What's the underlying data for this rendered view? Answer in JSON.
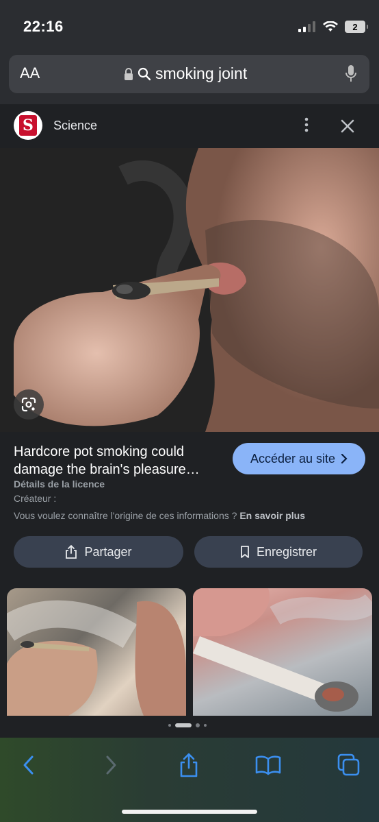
{
  "status_bar": {
    "time": "22:16",
    "battery": "2"
  },
  "url_bar": {
    "text_size_label": "AA",
    "query": "smoking joint"
  },
  "source": {
    "logo_letter": "S",
    "name": "Science"
  },
  "result": {
    "title": "Hardcore pot smoking could damage the brain's pleasure…",
    "visit_label": "Accéder au site",
    "license_label": "Détails de la licence",
    "creator_label": "Créateur :",
    "origin_question": "Vous voulez connaître l'origine de ces informations ?",
    "learn_more_label": "En savoir plus"
  },
  "actions": {
    "share_label": "Partager",
    "save_label": "Enregistrer"
  },
  "toolbar": {
    "back": "back",
    "forward": "forward",
    "share": "share",
    "bookmarks": "bookmarks",
    "tabs": "tabs"
  },
  "colors": {
    "accent": "#8ab4f8",
    "ios_blue": "#3b8ff0",
    "pill_bg": "#394150"
  }
}
